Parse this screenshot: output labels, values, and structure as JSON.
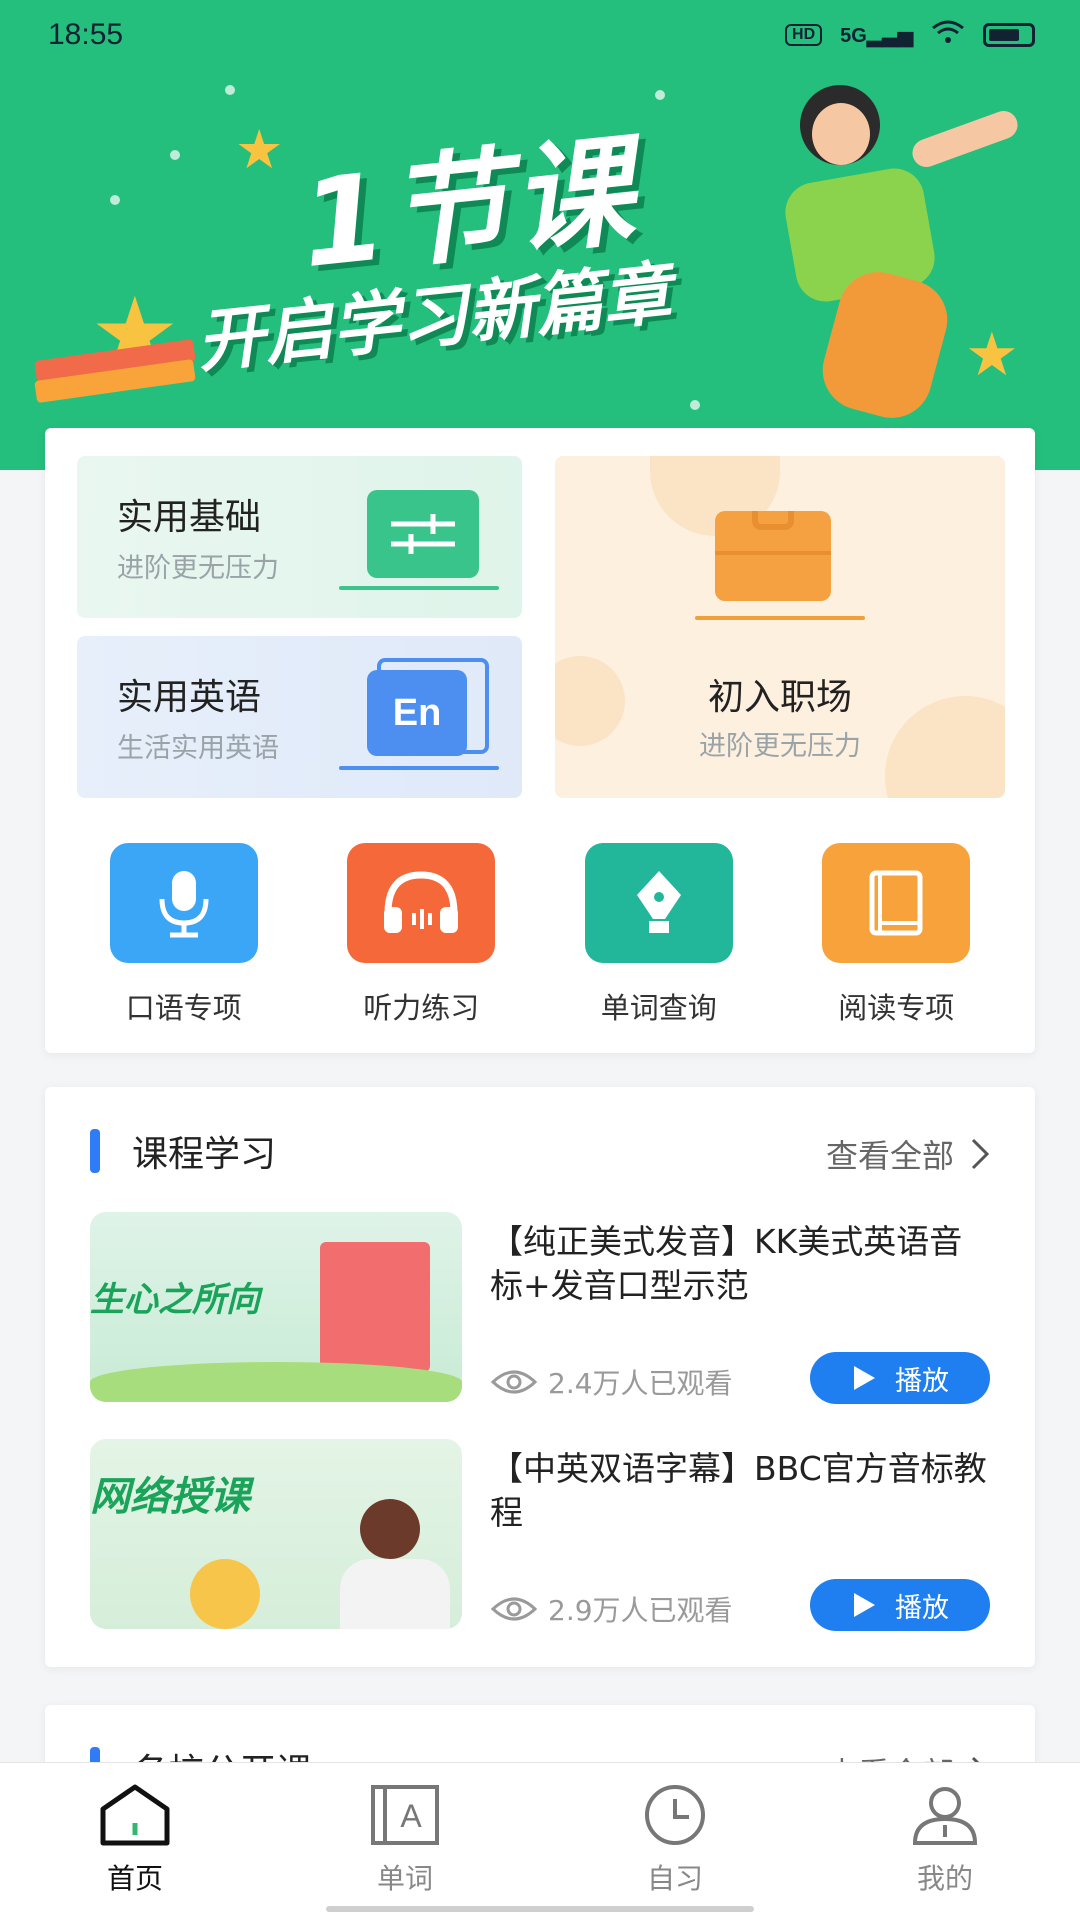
{
  "status": {
    "time": "18:55",
    "hd": "HD",
    "network": "5G"
  },
  "banner": {
    "title": "1节课",
    "subtitle": "开启学习新篇章"
  },
  "categories": [
    {
      "title": "实用基础",
      "subtitle": "进阶更无压力"
    },
    {
      "title": "实用英语",
      "subtitle": "生活实用英语",
      "icon_text": "En"
    },
    {
      "title": "初入职场",
      "subtitle": "进阶更无压力"
    }
  ],
  "features": [
    {
      "label": "口语专项",
      "icon": "microphone-icon",
      "color": "#3aa6f5"
    },
    {
      "label": "听力练习",
      "icon": "headphones-icon",
      "color": "#f4683a"
    },
    {
      "label": "单词查询",
      "icon": "pen-nib-icon",
      "color": "#22b69a"
    },
    {
      "label": "阅读专项",
      "icon": "book-icon",
      "color": "#f7a23a"
    }
  ],
  "course_section": {
    "title": "课程学习",
    "view_all": "查看全部"
  },
  "courses": [
    {
      "title": "【纯正美式发音】KK美式英语音标+发音口型示范",
      "views": "2.4万人已观看",
      "play": "播放",
      "thumb_text": "生心之所向"
    },
    {
      "title": "【中英双语字幕】BBC官方音标教程",
      "views": "2.9万人已观看",
      "play": "播放",
      "thumb_text": "网络授课"
    }
  ],
  "next_section": {
    "title": "名校公开课",
    "view_all": "查看全部"
  },
  "nav": [
    {
      "label": "首页",
      "icon": "home-icon"
    },
    {
      "label": "单词",
      "icon": "word-book-icon"
    },
    {
      "label": "自习",
      "icon": "clock-icon"
    },
    {
      "label": "我的",
      "icon": "user-icon"
    }
  ],
  "colors": {
    "brand_green": "#24bf7c",
    "accent_blue": "#1f7ff0"
  }
}
